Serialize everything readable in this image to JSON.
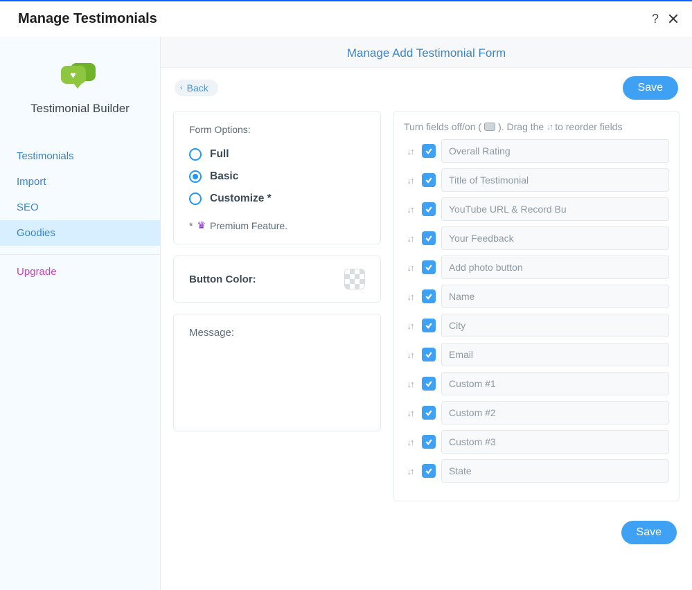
{
  "header": {
    "title": "Manage Testimonials"
  },
  "sidebar": {
    "title": "Testimonial Builder",
    "items": [
      {
        "label": "Testimonials"
      },
      {
        "label": "Import"
      },
      {
        "label": "SEO"
      },
      {
        "label": "Goodies",
        "active": true
      }
    ],
    "upgrade": "Upgrade"
  },
  "barTitle": "Manage Add Testimonial Form",
  "toolbar": {
    "back": "Back",
    "save": "Save"
  },
  "formOptions": {
    "title": "Form Options:",
    "options": [
      {
        "label": "Full",
        "checked": false
      },
      {
        "label": "Basic",
        "checked": true
      },
      {
        "label": "Customize *",
        "checked": false
      }
    ],
    "premium": "Premium Feature.",
    "asterisk": "*"
  },
  "buttonColor": {
    "label": "Button Color:"
  },
  "message": {
    "label": "Message:"
  },
  "instructions": {
    "textA": "Turn fields off/on (",
    "textB": "). Drag the ",
    "textC": " to reorder fields"
  },
  "fields": [
    {
      "label": "Overall Rating",
      "checked": true
    },
    {
      "label": "Title of Testimonial",
      "checked": true
    },
    {
      "label": "YouTube URL & Record Bu",
      "checked": true
    },
    {
      "label": "Your Feedback",
      "checked": true
    },
    {
      "label": "Add photo button",
      "checked": true
    },
    {
      "label": "Name",
      "checked": true
    },
    {
      "label": "City",
      "checked": true
    },
    {
      "label": "Email",
      "checked": true
    },
    {
      "label": "Custom #1",
      "checked": true
    },
    {
      "label": "Custom #2",
      "checked": true
    },
    {
      "label": "Custom #3",
      "checked": true
    },
    {
      "label": "State",
      "checked": true
    }
  ],
  "footer": {
    "save": "Save"
  }
}
